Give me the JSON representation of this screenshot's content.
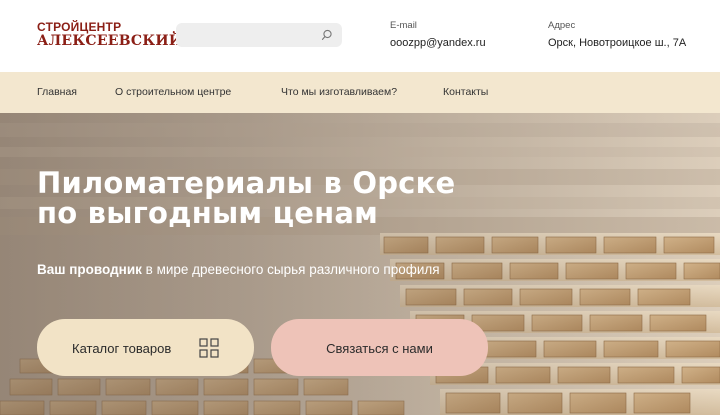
{
  "header": {
    "logo_top": "СТРОЙЦЕНТР",
    "logo_bottom": "АЛЕКСЕЕВСКИЙ",
    "search_placeholder": "",
    "email_label": "E-mail",
    "email_value": "ooozpp@yandex.ru",
    "address_label": "Адрес",
    "address_value": "Орск, Новотроицкое ш., 7А"
  },
  "nav": {
    "items": [
      {
        "label": "Главная"
      },
      {
        "label": "О строительном центре"
      },
      {
        "label": "Что мы изготавливаем?"
      },
      {
        "label": "Контакты"
      }
    ]
  },
  "hero": {
    "title_line1": "Пиломатериалы в Орске",
    "title_line2": "по выгодным ценам",
    "subtitle_bold": "Ваш проводник",
    "subtitle_rest": " в мире древесного сырья различного профиля",
    "catalog_button": "Каталог товаров",
    "contact_button": "Связаться с нами"
  },
  "icons": {
    "search": "search-icon",
    "catalog": "grid-icon"
  },
  "colors": {
    "brand": "#8b1f16",
    "nav_bg": "#f3e7cf",
    "catalog_button": "#f2e3c6",
    "contact_button": "#eec3b8"
  }
}
